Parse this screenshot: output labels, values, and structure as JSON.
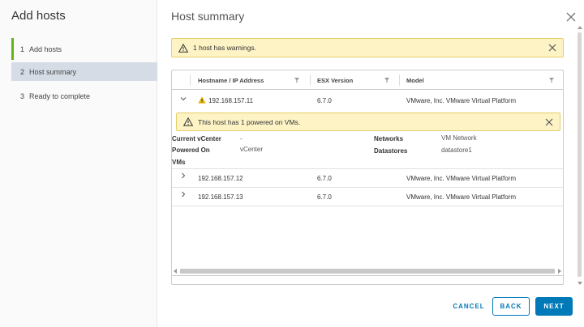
{
  "wizard": {
    "title": "Add hosts",
    "steps": [
      {
        "num": "1",
        "label": "Add hosts"
      },
      {
        "num": "2",
        "label": "Host summary"
      },
      {
        "num": "3",
        "label": "Ready to complete"
      }
    ]
  },
  "main": {
    "title": "Host summary",
    "top_alert": "1 host has warnings."
  },
  "grid": {
    "columns": [
      "Hostname / IP Address",
      "ESX Version",
      "Model"
    ],
    "rows": [
      {
        "host": "192.168.157.11",
        "version": "6.7.0",
        "model": "VMware, Inc. VMware Virtual Platform"
      },
      {
        "host": "192.168.157.12",
        "version": "6.7.0",
        "model": "VMware, Inc. VMware Virtual Platform"
      },
      {
        "host": "192.168.157.13",
        "version": "6.7.0",
        "model": "VMware, Inc. VMware Virtual Platform"
      }
    ],
    "detail": {
      "alert": "This host has 1 powered on VMs.",
      "current_vcenter_label": "Current vCenter",
      "current_vcenter_value": "-",
      "powered_on_vms_label_1": "Powered On",
      "powered_on_vms_label_2": "VMs",
      "powered_on_vms_value": "vCenter",
      "networks_label": "Networks",
      "networks_value": "VM Network",
      "datastores_label": "Datastores",
      "datastores_value": "datastore1"
    }
  },
  "buttons": {
    "cancel": "CANCEL",
    "back": "BACK",
    "next": "NEXT"
  },
  "colors": {
    "accent": "#0079b8",
    "step_done": "#60b515",
    "warning_bg": "#fdf3c5",
    "warning_icon": "#e8b400"
  }
}
